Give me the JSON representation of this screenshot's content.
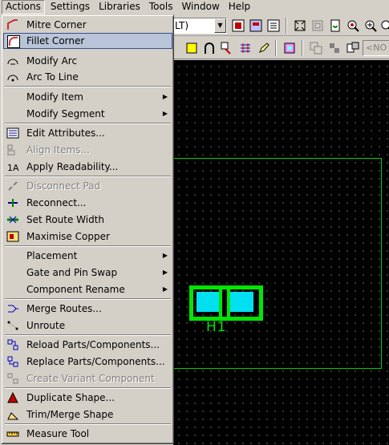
{
  "menubar": {
    "items": [
      "Actions",
      "Settings",
      "Libraries",
      "Tools",
      "Window",
      "Help"
    ]
  },
  "toolbar": {
    "combo_value": "LT)",
    "no_field": "<NO"
  },
  "actions_menu": {
    "groups": [
      [
        "Mitre Corner",
        "Fillet Corner",
        "Modify Arc",
        "Arc To Line"
      ],
      [
        "Modify Item",
        "Modify Segment"
      ],
      [
        "Edit Attributes...",
        "Align Items...",
        "Apply Readability..."
      ],
      [
        "Disconnect Pad",
        "Reconnect...",
        "Set Route Width",
        "Maximise Copper"
      ],
      [
        "Placement",
        "Gate and Pin Swap",
        "Component Rename"
      ],
      [
        "Merge Routes...",
        "Unroute"
      ],
      [
        "Reload Parts/Components...",
        "Replace Parts/Components...",
        "Create Variant Component"
      ],
      [
        "Duplicate Shape...",
        "Trim/Merge Shape"
      ],
      [
        "Measure Tool"
      ]
    ],
    "items": {
      "mitre_corner": "Mitre Corner",
      "fillet_corner": "Fillet Corner",
      "modify_arc": "Modify Arc",
      "arc_to_line": "Arc To Line",
      "modify_item": "Modify Item",
      "modify_segment": "Modify Segment",
      "edit_attributes": "Edit Attributes...",
      "align_items": "Align Items...",
      "apply_readability": "Apply Readability...",
      "disconnect_pad": "Disconnect Pad",
      "reconnect": "Reconnect...",
      "set_route_width": "Set Route Width",
      "maximise_copper": "Maximise Copper",
      "placement": "Placement",
      "gate_pin_swap": "Gate and Pin Swap",
      "component_rename": "Component Rename",
      "merge_routes": "Merge Routes...",
      "unroute": "Unroute",
      "reload_parts": "Reload Parts/Components...",
      "replace_parts": "Replace Parts/Components...",
      "create_variant": "Create Variant Component",
      "duplicate_shape": "Duplicate Shape...",
      "trim_merge_shape": "Trim/Merge Shape",
      "measure_tool": "Measure Tool"
    },
    "selected": "Fillet Corner",
    "disabled": [
      "Align Items...",
      "Disconnect Pad",
      "Create Variant Component"
    ],
    "submenus": [
      "Modify Item",
      "Modify Segment",
      "Placement",
      "Gate and Pin Swap",
      "Component Rename"
    ]
  },
  "canvas": {
    "component_refdes": "H1",
    "colors": {
      "background": "#000000",
      "board_outline": "#00d000",
      "component_outline": "#00e600",
      "pad": "#00e0f0",
      "grid_dot": "#3c4a3c"
    }
  },
  "icons": {
    "toolbar1": [
      "fit-view-icon",
      "zoom-area-icon",
      "refresh-icon",
      "zoom-icon",
      "zoom-in-icon"
    ],
    "toolbar2": [
      "yellow-square-icon",
      "arch-icon",
      "route-icon",
      "grid-icon",
      "pen-icon",
      "shape-icon",
      "copy-icon",
      "paste-icon",
      "arrange-icon"
    ]
  }
}
